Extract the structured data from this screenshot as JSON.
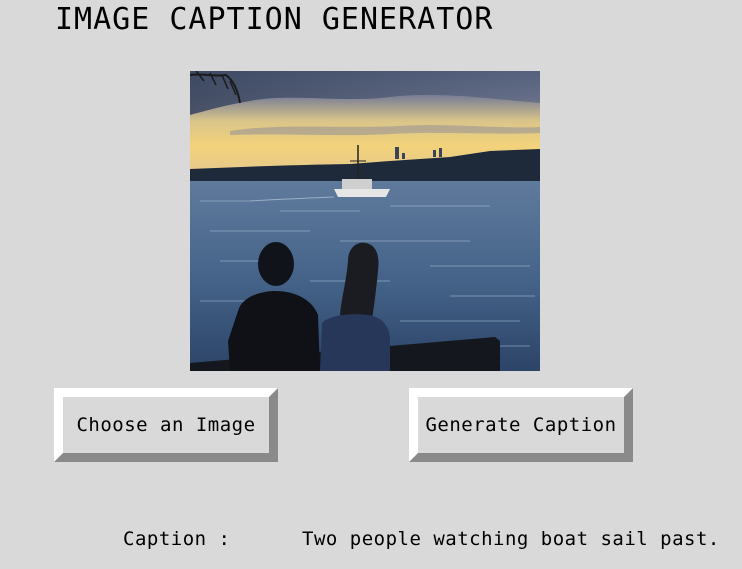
{
  "app": {
    "title": "IMAGE CAPTION GENERATOR"
  },
  "image": {
    "subject": "two people on a bench watching a boat sail past on water at sunset"
  },
  "buttons": {
    "choose_label": "Choose an Image",
    "generate_label": "Generate Caption"
  },
  "caption": {
    "label": "Caption :",
    "text": "Two people watching boat sail past."
  },
  "colors": {
    "window_bg": "#d9d9d9",
    "button_highlight": "#ffffff",
    "button_shadow": "#8a8a8a"
  }
}
